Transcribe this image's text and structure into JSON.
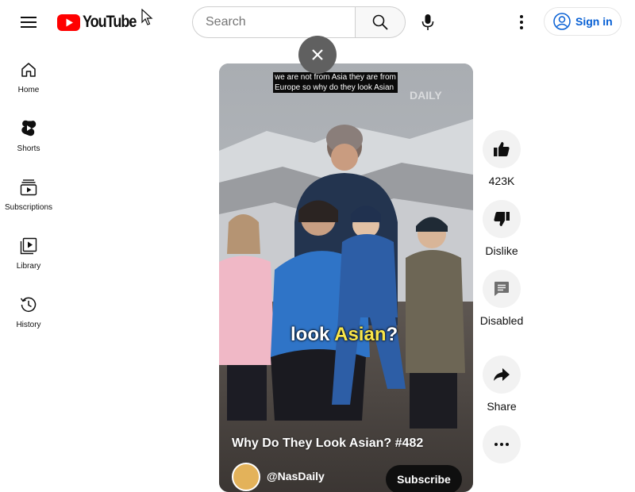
{
  "header": {
    "logo_text": "YouTube",
    "search_placeholder": "Search",
    "sign_in_label": "Sign in"
  },
  "sidebar": {
    "items": [
      {
        "label": "Home",
        "icon": "home-icon"
      },
      {
        "label": "Shorts",
        "icon": "shorts-icon"
      },
      {
        "label": "Subscriptions",
        "icon": "subscriptions-icon"
      },
      {
        "label": "Library",
        "icon": "library-icon"
      },
      {
        "label": "History",
        "icon": "history-icon"
      }
    ]
  },
  "short": {
    "caption_line1": "we are not from Asia they are from",
    "caption_line2": "Europe so why do they look Asian",
    "watermark": "DAILY",
    "overlay_text_plain": "look ",
    "overlay_text_highlight": "Asian",
    "overlay_text_end": "?",
    "title": "Why Do They Look Asian? #482",
    "channel_name": "@NasDaily",
    "subscribe_label": "Subscribe"
  },
  "actions": {
    "like_count": "423K",
    "dislike_label": "Dislike",
    "comments_label": "Disabled",
    "share_label": "Share"
  },
  "colors": {
    "brand_red": "#ff0000",
    "link_blue": "#065fd4",
    "highlight_yellow": "#f9e64a"
  }
}
